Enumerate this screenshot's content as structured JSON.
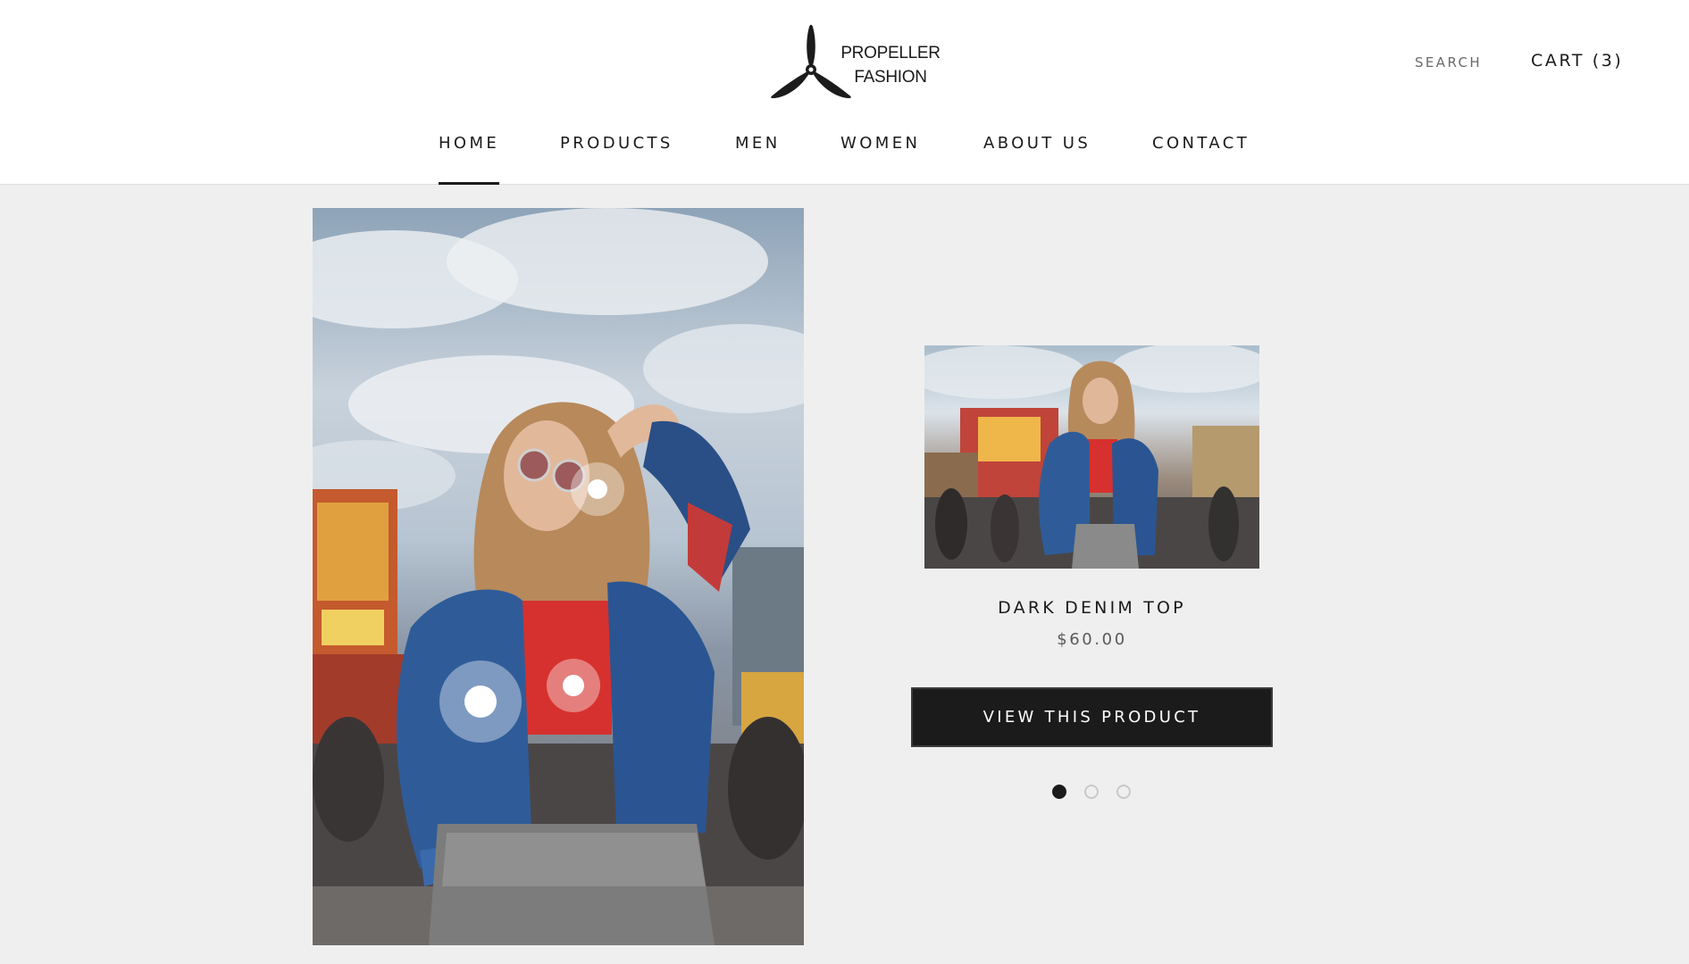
{
  "brand": {
    "name_line1": "PROPELLER",
    "name_line2": "FASHION"
  },
  "header": {
    "search_label": "SEARCH",
    "cart_label": "CART (3)",
    "load_progress": 0.166
  },
  "nav": {
    "items": [
      {
        "label": "HOME",
        "active": true
      },
      {
        "label": "PRODUCTS",
        "active": false
      },
      {
        "label": "MEN",
        "active": false
      },
      {
        "label": "WOMEN",
        "active": false
      },
      {
        "label": "ABOUT US",
        "active": false
      },
      {
        "label": "CONTACT",
        "active": false
      }
    ]
  },
  "hero": {
    "image": "woman-denim-jacket-photo",
    "hotspots": 3
  },
  "product": {
    "image": "denim-jacket-carnival-photo",
    "title": "DARK DENIM TOP",
    "price": "$60.00",
    "button_label": "VIEW THIS PRODUCT"
  },
  "carousel": {
    "total": 3,
    "active_index": 0
  },
  "colors": {
    "text": "#1c1b1b",
    "background": "#efefef",
    "button": "#1c1b1b",
    "progress": "#1f7ee8"
  }
}
